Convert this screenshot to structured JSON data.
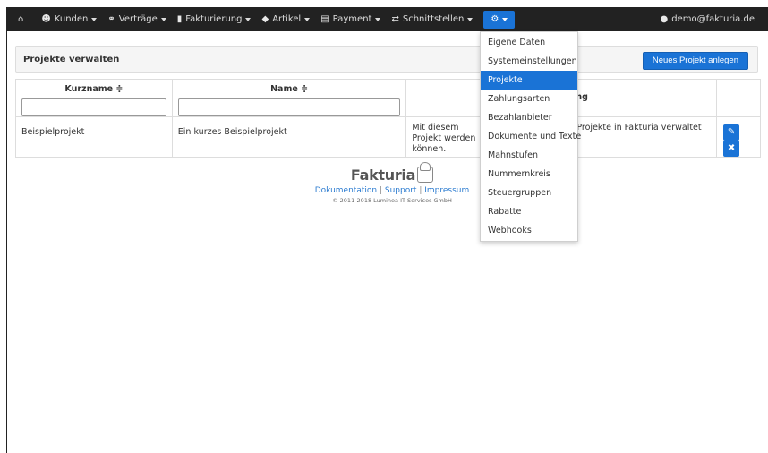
{
  "navbar": {
    "items": [
      {
        "name": "kunden",
        "icon": "users-icon",
        "label": "Kunden",
        "has_caret": true
      },
      {
        "name": "vertraege",
        "icon": "handshake-icon",
        "label": "Verträge",
        "has_caret": true
      },
      {
        "name": "fakturierung",
        "icon": "book-icon",
        "label": "Fakturierung",
        "has_caret": true
      },
      {
        "name": "artikel",
        "icon": "tag-icon",
        "label": "Artikel",
        "has_caret": true
      },
      {
        "name": "payment",
        "icon": "credit-card-icon",
        "label": "Payment",
        "has_caret": true
      },
      {
        "name": "schnittstellen",
        "icon": "exchange-icon",
        "label": "Schnittstellen",
        "has_caret": true
      }
    ],
    "user": "demo@fakturia.de"
  },
  "panel": {
    "title": "Projekte verwalten",
    "new_button": "Neues Projekt anlegen"
  },
  "table": {
    "columns": {
      "kurzname": "Kurzname ≑",
      "name": "Name ≑",
      "beschreibung_fragment": "ng"
    },
    "rows": [
      {
        "kurzname": "Beispielprojekt",
        "name": "Ein kurzes Beispielprojekt",
        "beschreibung_left": "Mit diesem Projekt werden können.",
        "beschreibung_right": "Projekte in Fakturia verwaltet"
      }
    ]
  },
  "footer": {
    "logo": "Fakturia",
    "links": [
      "Dokumentation",
      "Support",
      "Impressum"
    ],
    "copyright": "© 2011-2018 Luminea IT Services GmbH"
  },
  "dropdown": {
    "items": [
      "Eigene Daten",
      "Systemeinstellungen",
      "Projekte",
      "Zahlungsarten",
      "Bezahlanbieter",
      "Dokumente und Texte",
      "Mahnstufen",
      "Nummernkreis",
      "Steuergruppen",
      "Rabatte",
      "Webhooks"
    ],
    "active_index": 2
  },
  "colors": {
    "navbar_bg": "#222222",
    "accent": "#1a73d6"
  }
}
